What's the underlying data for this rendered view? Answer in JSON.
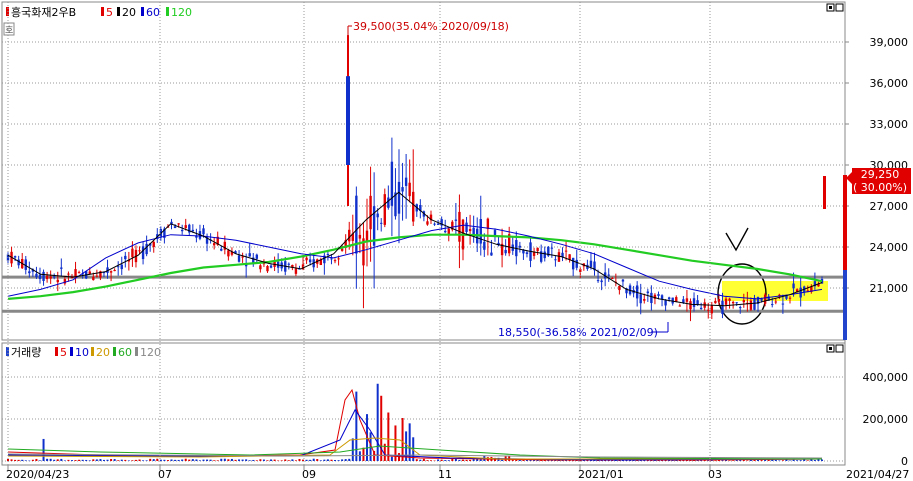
{
  "chart_data": [
    {
      "type": "candlestick",
      "title": "흥국화재2우B",
      "legend": [
        {
          "label": "5",
          "color": "#e00000"
        },
        {
          "label": "20",
          "color": "#000000"
        },
        {
          "label": "60",
          "color": "#0000cc"
        },
        {
          "label": "120",
          "color": "#22cc22"
        }
      ],
      "ylim": [
        18000,
        42000
      ],
      "yticks": [
        "39,000",
        "36,000",
        "33,000",
        "30,000",
        "27,000",
        "24,000",
        "21,000"
      ],
      "ytick_values": [
        39000,
        36000,
        33000,
        30000,
        27000,
        24000,
        21000
      ],
      "current_price": "29,250",
      "current_change": "( 30.00%)",
      "high_annotation": "39,500(35.04% 2020/09/18)",
      "low_annotation": "18,550(-36.58% 2021/02/09)",
      "horizontal_lines": [
        21800,
        19300
      ],
      "ma120_path_values": [
        20200,
        20400,
        20700,
        21100,
        21600,
        22100,
        22500,
        22700,
        22900,
        23300,
        23800,
        24400,
        24700,
        24900,
        24900,
        24800,
        24700,
        24500,
        24200,
        23800,
        23400,
        23000,
        22700,
        22400,
        22000,
        21500
      ],
      "ma60_path_values": [
        20400,
        20900,
        21600,
        23200,
        24300,
        24900,
        24800,
        24500,
        24000,
        23500,
        23200,
        23800,
        24500,
        25200,
        25600,
        25300,
        24800,
        24200,
        23500,
        22500,
        21500,
        20900,
        20400,
        20200,
        20500,
        20900
      ],
      "ma20_path_values": [
        23400,
        22000,
        21800,
        22200,
        23400,
        25700,
        24800,
        23500,
        22800,
        22400,
        23500,
        26000,
        28000,
        26000,
        25000,
        24200,
        23700,
        23300,
        22400,
        20900,
        20200,
        19800,
        19700,
        19900,
        20500,
        21400
      ]
    },
    {
      "type": "volume",
      "title": "거래량",
      "legend": [
        {
          "label": "5",
          "color": "#e00000"
        },
        {
          "label": "10",
          "color": "#0000cc"
        },
        {
          "label": "20",
          "color": "#cc9900"
        },
        {
          "label": "60",
          "color": "#22aa22"
        },
        {
          "label": "120",
          "color": "#888888"
        }
      ],
      "ylim": [
        0,
        500000
      ],
      "yticks": [
        "400,000",
        "200,000",
        "0"
      ],
      "ytick_values": [
        400000,
        200000,
        0
      ],
      "xticks": [
        "2020/04/23",
        "07",
        "09",
        "11",
        "2021/01",
        "03",
        "2021/04/27"
      ]
    }
  ]
}
